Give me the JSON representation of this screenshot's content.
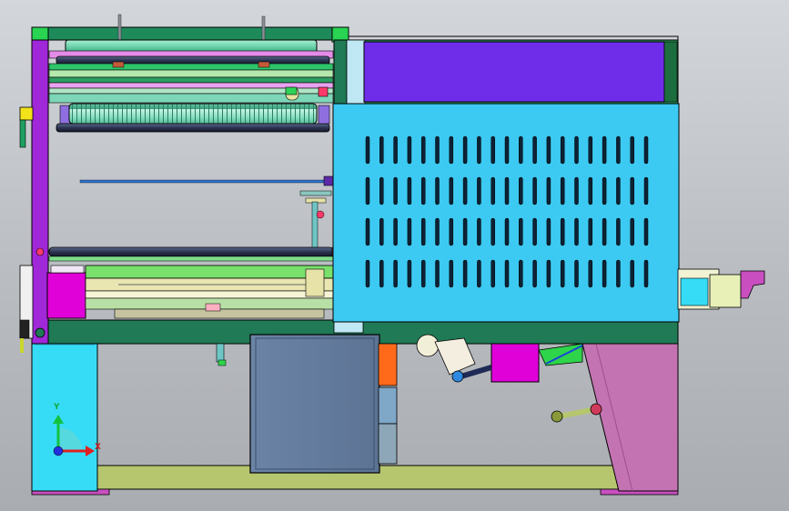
{
  "viewport": {
    "triad": {
      "y_label": "Y",
      "x_label": "X"
    }
  },
  "colors": {
    "frame_purple": "#a028d8",
    "frame_green": "#1f7a55",
    "cover_cyan": "#3ccaf2",
    "rail_green": "#7fe66f",
    "roller_dark": "#34405c",
    "motor_magenta": "#e000d8",
    "panel_blue": "#6a7fa0",
    "base_olive": "#b5c66e",
    "slant_mauve": "#c06fae"
  },
  "model_parts": [
    "main-frame",
    "left-side-plate",
    "top-right-housing",
    "access-panel",
    "upper-roller-assembly",
    "lower-roller",
    "slide-rail-assembly",
    "lower-left-cabinet",
    "control-box",
    "drive-motor",
    "base-rail",
    "slanted-guard",
    "output-bracket"
  ]
}
